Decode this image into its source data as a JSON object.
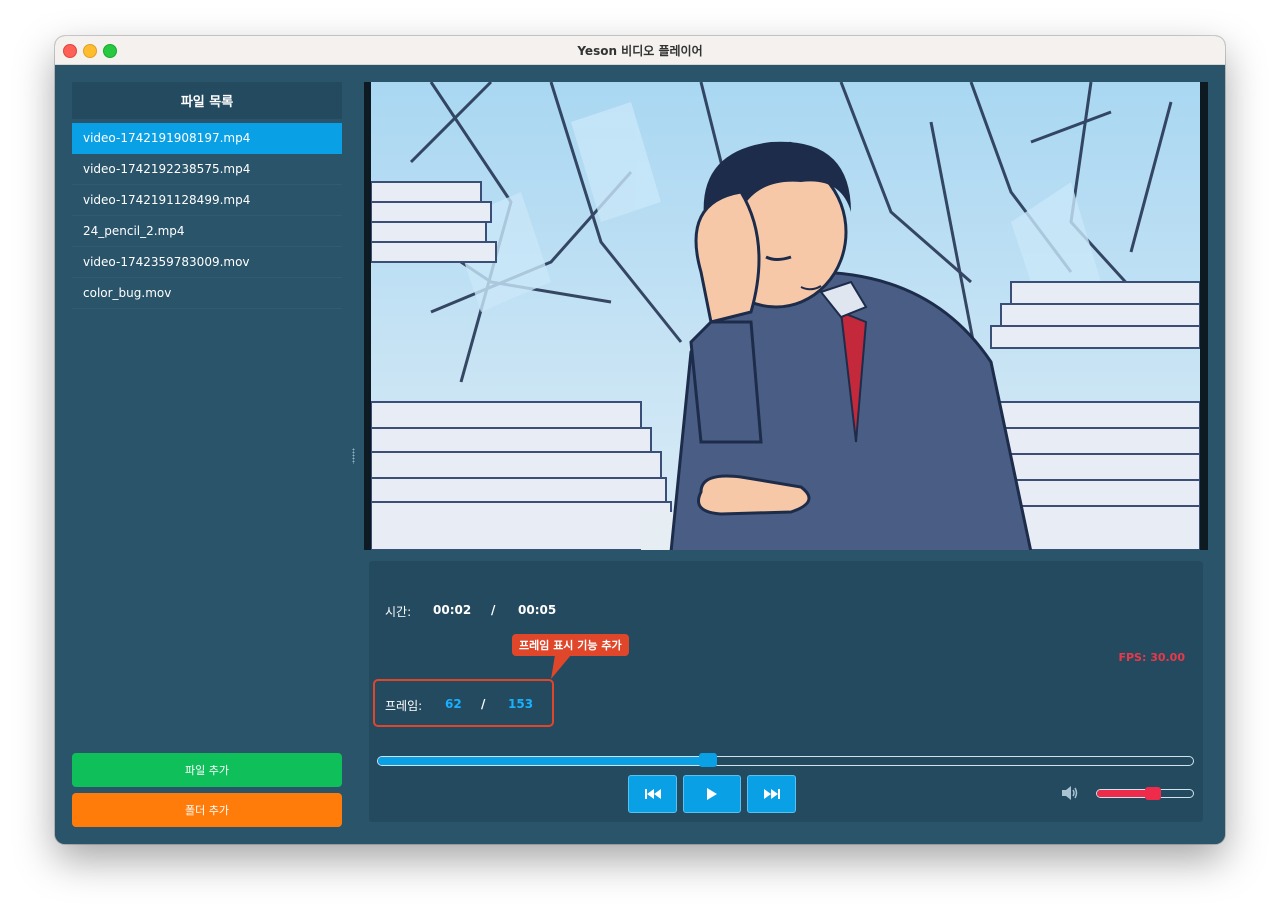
{
  "window": {
    "title": "Yeson 비디오 플레이어"
  },
  "sidebar": {
    "header": "파일 목록",
    "files": [
      {
        "name": "video-1742191908197.mp4",
        "selected": true
      },
      {
        "name": "video-1742192238575.mp4",
        "selected": false
      },
      {
        "name": "video-1742191128499.mp4",
        "selected": false
      },
      {
        "name": "24_pencil_2.mp4",
        "selected": false
      },
      {
        "name": "video-1742359783009.mov",
        "selected": false
      },
      {
        "name": "color_bug.mov",
        "selected": false
      }
    ],
    "add_file_label": "파일 추가",
    "add_folder_label": "폴더 추가"
  },
  "player": {
    "time_label": "시간:",
    "time_current": "00:02",
    "time_separator": "/",
    "time_total": "00:05",
    "fps_text": "FPS: 30.00",
    "frame_label": "프레임:",
    "frame_current": "62",
    "frame_separator": "/",
    "frame_total": "153",
    "annotation": "프레임 표시 기능 추가",
    "seek_position": 0.405,
    "volume_level": 0.58,
    "icons": {
      "prev": "skip-previous-icon",
      "play": "play-icon",
      "next": "skip-next-icon",
      "volume": "speaker-icon"
    }
  },
  "colors": {
    "accent": "#0aa0e6",
    "panel": "#29546a",
    "add_file": "#0fc05a",
    "add_folder": "#ff7b0a",
    "fps": "#e8394a",
    "frame_value": "#19b1ff",
    "annotation": "#e0462a",
    "volume": "#ee2b4a"
  }
}
